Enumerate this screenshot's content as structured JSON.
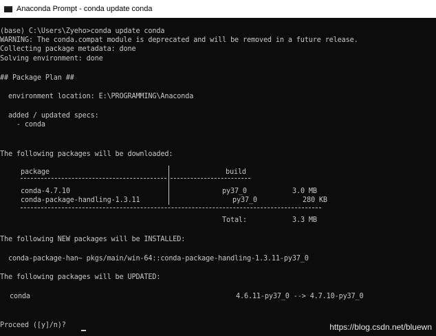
{
  "window": {
    "title": "Anaconda Prompt - conda  update conda",
    "icon": "terminal-icon"
  },
  "terminal": {
    "lines": [
      "(base) C:\\Users\\Zyeho>conda update conda",
      "WARNING: The conda.compat module is deprecated and will be removed in a future release.",
      "Collecting package metadata: done",
      "Solving environment: done",
      "## Package Plan ##",
      "  environment location: E:\\PROGRAMMING\\Anaconda",
      "  added / updated specs:",
      "    - conda",
      "The following packages will be downloaded:",
      "The following NEW packages will be INSTALLED:",
      "  conda-package-han~ pkgs/main/win-64::conda-package-handling-1.3.11-py37_0",
      "The following packages will be UPDATED:"
    ],
    "download_table": {
      "headers": [
        "package",
        "build"
      ],
      "rows": [
        [
          "conda-4.7.10",
          "py37_0",
          "3.0 MB"
        ],
        [
          "conda-package-handling-1.3.11",
          "py37_0",
          "280 KB"
        ]
      ],
      "total_label": "Total:",
      "total_value": "3.3 MB"
    },
    "updated": {
      "package": "conda",
      "change": "4.6.11-py37_0 --> 4.7.10-py37_0"
    },
    "prompt": "Proceed ([y]/n)? "
  },
  "watermark": "https://blog.csdn.net/bluewn",
  "colors": {
    "background": "#0c0c0c",
    "text": "#c8c8c8",
    "titlebar": "#ffffff"
  }
}
